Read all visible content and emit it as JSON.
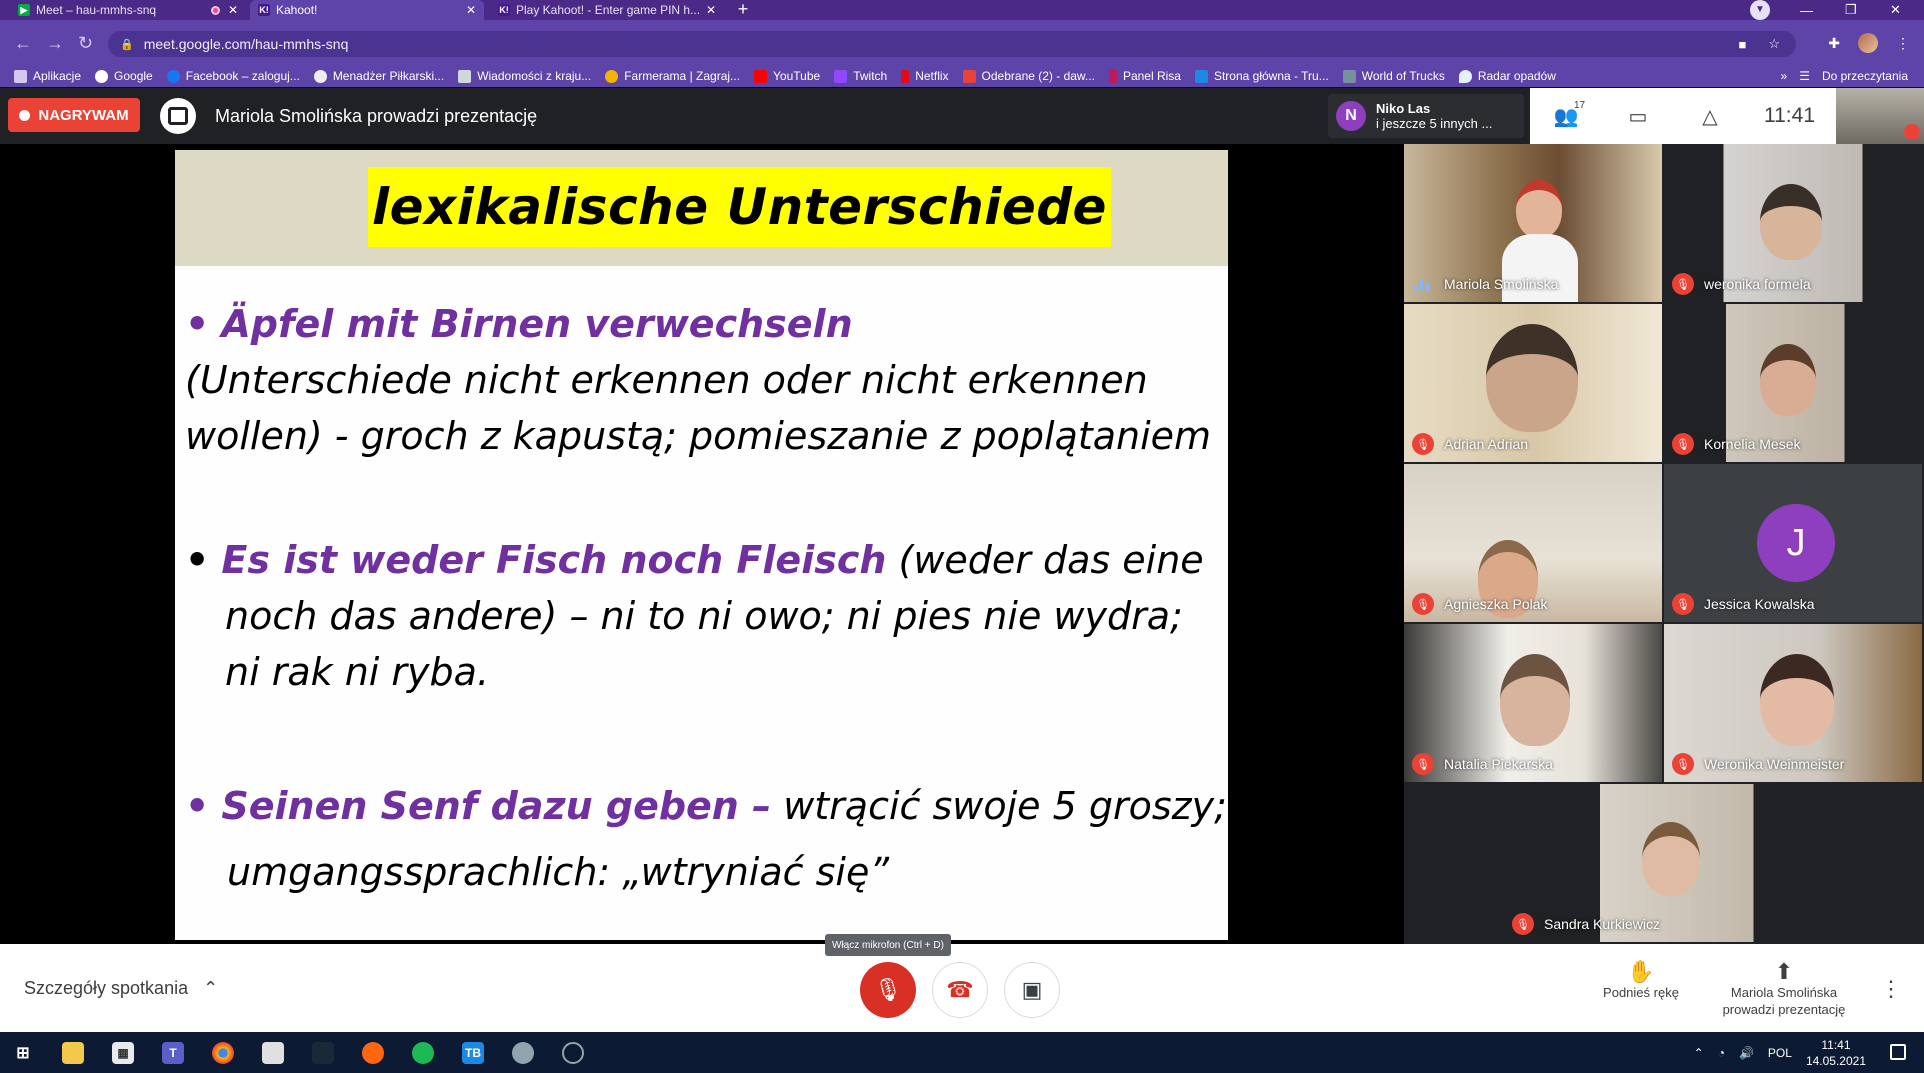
{
  "browser": {
    "tabs": [
      {
        "title": "Meet – hau-mmhs-snq",
        "favicon": "meet-icon",
        "recording": true
      },
      {
        "title": "Kahoot!",
        "favicon": "kahoot-icon"
      },
      {
        "title": "Play Kahoot! - Enter game PIN h...",
        "favicon": "kahoot-icon"
      }
    ],
    "url": "meet.google.com/hau-mmhs-snq",
    "bookmarks": [
      "Aplikacje",
      "Google",
      "Facebook – zaloguj...",
      "Menadżer Piłkarski...",
      "Wiadomości z kraju...",
      "Farmerama | Zagraj...",
      "YouTube",
      "Twitch",
      "Netflix",
      "Odebrane (2) - daw...",
      "Panel Risa",
      "Strona główna - Tru...",
      "World of Trucks",
      "Radar opadów"
    ],
    "reading_list": "Do przeczytania"
  },
  "meet": {
    "recording_label": "NAGRYWAM",
    "presenter_banner": "Mariola Smolińska prowadzi prezentację",
    "join_notice": {
      "initial": "N",
      "name": "Niko Las",
      "others": "i jeszcze 5 innych ..."
    },
    "people_count": "17",
    "clock": "11:41"
  },
  "slide": {
    "title": "lexikalische Unterschiede",
    "items": [
      {
        "term": "Äpfel mit Birnen verwechseln",
        "line1": "(Unterschiede nicht erkennen oder nicht erkennen",
        "line2": "wollen) - groch z kapustą; pomieszanie z poplątaniem"
      },
      {
        "term": "Es ist weder Fisch noch Fleisch",
        "tail": "(weder das eine",
        "line1": "noch das andere) – ni to ni owo; ni pies nie wydra;",
        "line2": "ni rak ni ryba."
      },
      {
        "term": "Seinen Senf dazu geben –",
        "tail": "wtrącić swoje 5 groszy;",
        "line1": "umgangssprachlich: „wtryniać się”"
      }
    ]
  },
  "participants": [
    {
      "name": "Mariola Smolińska",
      "status": "speaking"
    },
    {
      "name": "weronika formela",
      "status": "muted"
    },
    {
      "name": "Adrian Adrian",
      "status": "muted"
    },
    {
      "name": "Kornelia Mesek",
      "status": "muted"
    },
    {
      "name": "Agnieszka Polak",
      "status": "muted"
    },
    {
      "name": "Jessica Kowalska",
      "status": "muted",
      "initial": "J"
    },
    {
      "name": "Natalia Piekarska",
      "status": "muted"
    },
    {
      "name": "Weronika Weinmeister",
      "status": "muted"
    },
    {
      "name": "Sandra Kurkiewicz",
      "status": "muted"
    }
  ],
  "controls": {
    "meeting_details": "Szczegóły spotkania",
    "mic_tooltip": "Włącz mikrofon (Ctrl + D)",
    "raise_hand": "Podnieś rękę",
    "presenting_line1": "Mariola Smolińska",
    "presenting_line2": "prowadzi prezentację"
  },
  "taskbar": {
    "time": "11:41",
    "date": "14.05.2021",
    "lang": "POL"
  }
}
